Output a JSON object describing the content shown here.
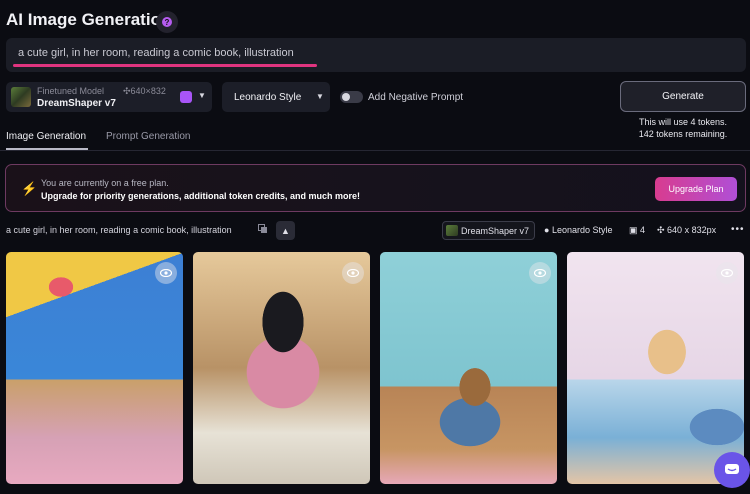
{
  "header": {
    "title": "AI Image Generation",
    "help_icon": "?"
  },
  "prompt": {
    "value": "a cute girl, in her room, reading a comic book, illustration"
  },
  "model_select": {
    "label": "Finetuned Model",
    "dims": "✣640×832",
    "name": "DreamShaper v7"
  },
  "style_select": {
    "value": "Leonardo Style"
  },
  "negative_prompt": {
    "label": "Add Negative Prompt",
    "enabled": false
  },
  "generate": {
    "label": "Generate",
    "tokens_line1": "This will use 4 tokens.",
    "tokens_line2": "142 tokens remaining."
  },
  "tabs": [
    {
      "label": "Image Generation",
      "active": true
    },
    {
      "label": "Prompt Generation",
      "active": false
    }
  ],
  "banner": {
    "line1": "You are currently on a free plan.",
    "line2": "Upgrade for priority generations, additional token credits, and much more!",
    "button": "Upgrade Plan"
  },
  "generation": {
    "prompt": "a cute girl, in her room, reading a comic book, illustration",
    "model": "DreamShaper v7",
    "style": "Leonardo Style",
    "count": "4",
    "dims": "640 x 832px"
  },
  "images": [
    {
      "name": "generated-image-1"
    },
    {
      "name": "generated-image-2"
    },
    {
      "name": "generated-image-3"
    },
    {
      "name": "generated-image-4"
    }
  ],
  "colors": {
    "accent_pink": "#e0347f",
    "accent_purple": "#a855f7",
    "chat_bubble": "#6a54e8"
  }
}
